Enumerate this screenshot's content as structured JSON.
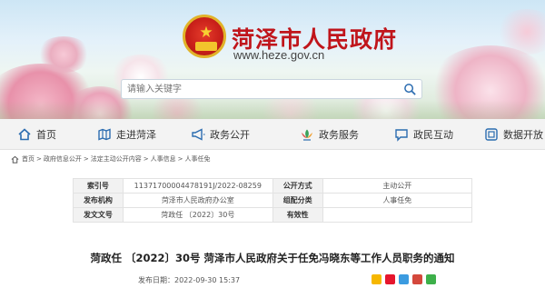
{
  "header": {
    "site_title": "菏泽市人民政府",
    "site_url": "www.heze.gov.cn",
    "search_placeholder": "请输入关键字"
  },
  "nav": {
    "items": [
      {
        "label": "首页",
        "icon": "home-icon"
      },
      {
        "label": "走进菏泽",
        "icon": "map-icon"
      },
      {
        "label": "政务公开",
        "icon": "megaphone-icon"
      },
      {
        "label": "政务服务",
        "icon": "lotus-icon"
      },
      {
        "label": "政民互动",
        "icon": "chat-icon"
      },
      {
        "label": "数据开放",
        "icon": "database-icon"
      }
    ]
  },
  "breadcrumb": [
    "首页",
    "政府信息公开",
    "法定主动公开内容",
    "人事信息",
    "人事任免"
  ],
  "meta": {
    "index_label": "索引号",
    "index_value": "11371700004478191J/2022-08259",
    "disclosure_label": "公开方式",
    "disclosure_value": "主动公开",
    "issuer_label": "发布机构",
    "issuer_value": "菏泽市人民政府办公室",
    "category_label": "组配分类",
    "category_value": "人事任免",
    "docno_label": "发文文号",
    "docno_value": "菏政任 〔2022〕30号",
    "validity_label": "有效性",
    "validity_value": ""
  },
  "doc": {
    "title": "菏政任 〔2022〕30号 菏泽市人民政府关于任免冯晓东等工作人员职务的通知",
    "publish_time": "发布日期：2022-09-30 15:37"
  },
  "colors": {
    "title_red": "#c0151b",
    "nav_bg": "#f3f3f3",
    "icon_blue": "#2b6cb0"
  }
}
